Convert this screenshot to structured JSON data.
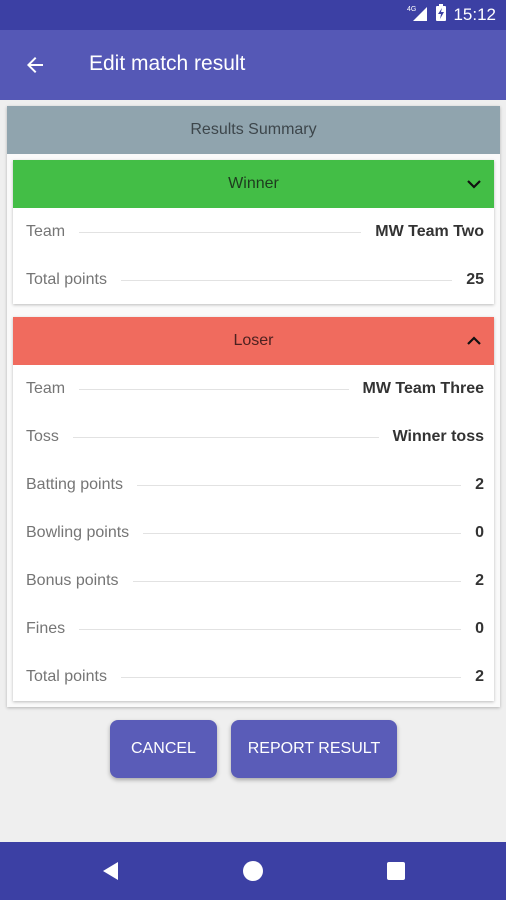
{
  "status_bar": {
    "network": "4G",
    "time": "15:12"
  },
  "app_bar": {
    "title": "Edit match result",
    "back_icon": "arrow-left-icon"
  },
  "summary": {
    "title": "Results Summary"
  },
  "winner": {
    "header": "Winner",
    "rows": [
      {
        "label": "Team",
        "value": "MW Team Two"
      },
      {
        "label": "Total points",
        "value": "25"
      }
    ]
  },
  "loser": {
    "header": "Loser",
    "rows": [
      {
        "label": "Team",
        "value": "MW Team Three"
      },
      {
        "label": "Toss",
        "value": "Winner toss"
      },
      {
        "label": "Batting points",
        "value": "2"
      },
      {
        "label": "Bowling points",
        "value": "0"
      },
      {
        "label": "Bonus points",
        "value": "2"
      },
      {
        "label": "Fines",
        "value": "0"
      },
      {
        "label": "Total points",
        "value": "2"
      }
    ]
  },
  "buttons": {
    "cancel": "CANCEL",
    "report": "REPORT RESULT"
  },
  "colors": {
    "primary": "#5558b6",
    "primary_dark": "#3c40a4",
    "winner": "#43be46",
    "loser": "#f06b5e",
    "summary_header": "#90a4ae"
  }
}
